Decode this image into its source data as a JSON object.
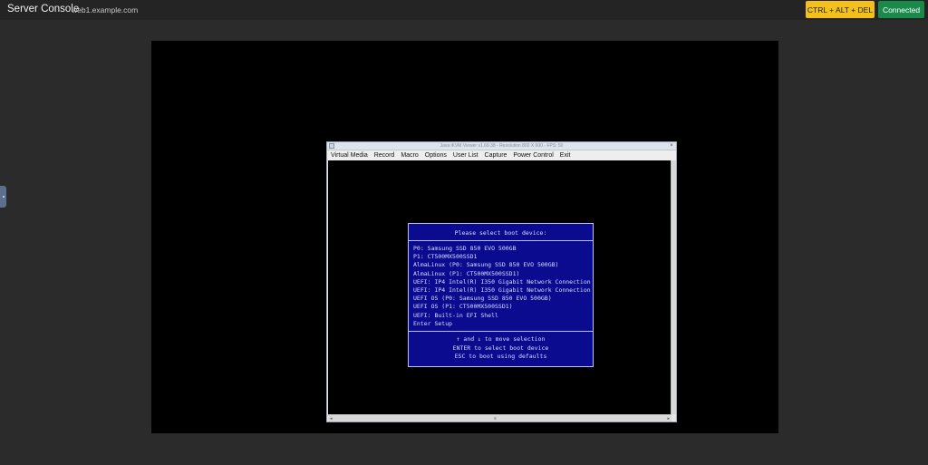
{
  "header": {
    "title": "Server Console",
    "host": "web1.example.com",
    "cad_label": "CTRL + ALT + DEL",
    "status_label": "Connected"
  },
  "java_window": {
    "title": "Java iKVM Viewer v1.69.38 - Resolution 800 X 600 - FPS: 50",
    "menu": [
      "Virtual Media",
      "Record",
      "Macro",
      "Options",
      "User List",
      "Capture",
      "Power Control",
      "Exit"
    ]
  },
  "boot_menu": {
    "header": "Please select boot device:",
    "items": [
      "P0: Samsung SSD 850 EVO 500GB",
      "P1: CT500MX500SSD1",
      "AlmaLinux (P0: Samsung SSD 850 EVO 500GB)",
      "AlmaLinux (P1: CT500MX500SSD1)",
      "UEFI: IP4 Intel(R) I350 Gigabit Network Connection",
      "UEFI: IP4 Intel(R) I350 Gigabit Network Connection",
      "UEFI OS (P0: Samsung SSD 850 EVO 500GB)",
      "UEFI OS (P1: CT500MX500SSD1)",
      "UEFI: Built-in EFI Shell",
      "Enter Setup"
    ],
    "selected_index": 0,
    "footer": [
      "↑ and ↓ to move selection",
      "ENTER to select boot device",
      "ESC to boot using defaults"
    ]
  },
  "colors": {
    "cad_button": "#f4c01b",
    "connected_button": "#1a8a4b",
    "bios_background": "#0b0b8f"
  }
}
